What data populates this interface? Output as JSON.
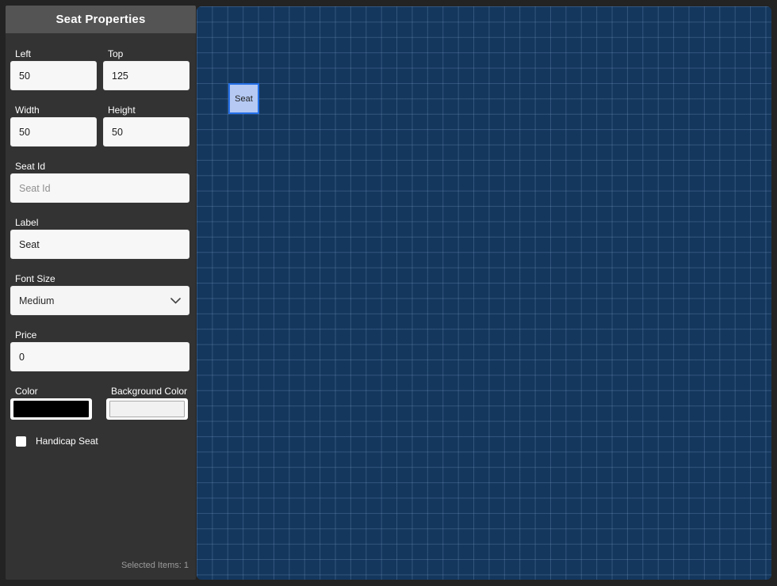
{
  "sidebar": {
    "title": "Seat Properties",
    "fields": {
      "left": {
        "label": "Left",
        "value": "50"
      },
      "top": {
        "label": "Top",
        "value": "125"
      },
      "width": {
        "label": "Width",
        "value": "50"
      },
      "height": {
        "label": "Height",
        "value": "50"
      },
      "seat_id": {
        "label": "Seat Id",
        "placeholder": "Seat Id",
        "value": ""
      },
      "label": {
        "label": "Label",
        "value": "Seat"
      },
      "font_size": {
        "label": "Font Size",
        "value": "Medium"
      },
      "price": {
        "label": "Price",
        "value": "0"
      },
      "color": {
        "label": "Color",
        "value": "#000000"
      },
      "background_color": {
        "label": "Background Color",
        "value": "#f1f1f1"
      },
      "handicap": {
        "label": "Handicap Seat",
        "checked": false
      }
    },
    "status": "Selected Items: 1"
  },
  "canvas": {
    "background": "#14375e",
    "grid_size_px": 19.4,
    "seat": {
      "label": "Seat",
      "fill": "#b5c9f3",
      "border": "#2470e8",
      "left_units": 50,
      "top_units": 125,
      "width_units": 50,
      "height_units": 50
    }
  }
}
